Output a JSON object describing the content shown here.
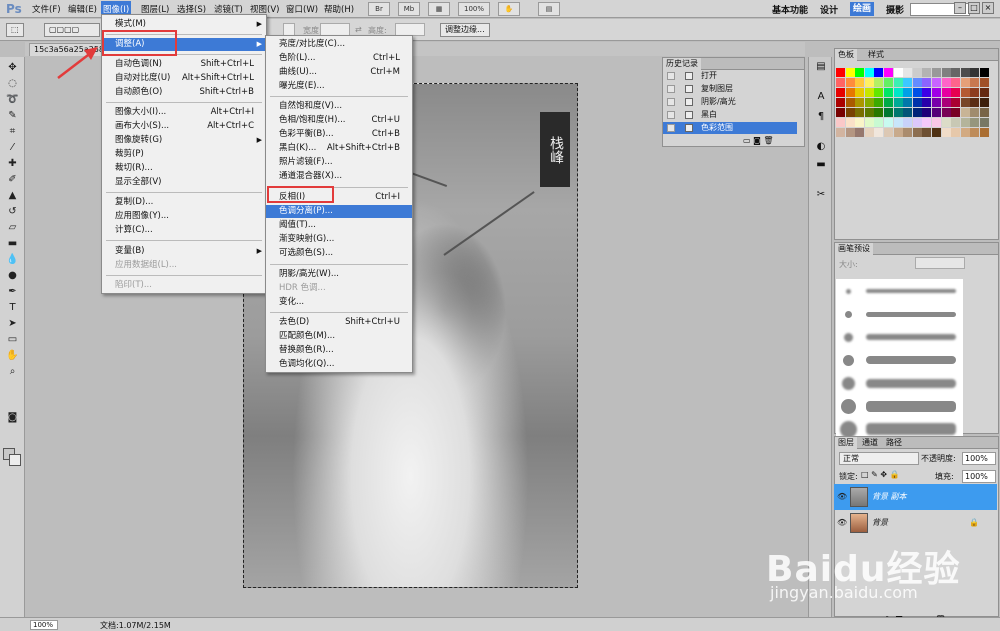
{
  "app": {
    "logo": "Ps"
  },
  "menubar": {
    "items": [
      "文件(F)",
      "编辑(E)",
      "图像(I)",
      "图层(L)",
      "选择(S)",
      "滤镜(T)",
      "视图(V)",
      "窗口(W)",
      "帮助(H)"
    ],
    "mini_buttons": [
      "Br",
      "Mb"
    ],
    "zoom": "100%",
    "workspaces": [
      "基本功能",
      "设计",
      "绘画",
      "摄影"
    ],
    "window_controls": [
      "–",
      "□",
      "×"
    ]
  },
  "options": {
    "adjust_edge": "调整边缘...",
    "width": "宽度:",
    "height": "高度:"
  },
  "document": {
    "tab": "15c3a56a25a2583"
  },
  "image_menu": {
    "items": [
      {
        "label": "模式(M)",
        "shortcut": "",
        "arrow": "▶"
      },
      {
        "label": "调整(A)",
        "shortcut": "",
        "arrow": "▶"
      },
      {
        "label": "自动色调(N)",
        "shortcut": "Shift+Ctrl+L"
      },
      {
        "label": "自动对比度(U)",
        "shortcut": "Alt+Shift+Ctrl+L"
      },
      {
        "label": "自动颜色(O)",
        "shortcut": "Shift+Ctrl+B"
      },
      {
        "label": "图像大小(I)...",
        "shortcut": "Alt+Ctrl+I"
      },
      {
        "label": "画布大小(S)...",
        "shortcut": "Alt+Ctrl+C"
      },
      {
        "label": "图像旋转(G)",
        "shortcut": "",
        "arrow": "▶"
      },
      {
        "label": "裁剪(P)",
        "shortcut": ""
      },
      {
        "label": "裁切(R)...",
        "shortcut": ""
      },
      {
        "label": "显示全部(V)",
        "shortcut": ""
      },
      {
        "label": "复制(D)...",
        "shortcut": ""
      },
      {
        "label": "应用图像(Y)...",
        "shortcut": ""
      },
      {
        "label": "计算(C)...",
        "shortcut": ""
      },
      {
        "label": "变量(B)",
        "shortcut": "",
        "arrow": "▶"
      },
      {
        "label": "应用数据组(L)...",
        "shortcut": ""
      },
      {
        "label": "陷印(T)...",
        "shortcut": ""
      }
    ]
  },
  "adjust_menu": {
    "items": [
      {
        "label": "亮度/对比度(C)...",
        "shortcut": ""
      },
      {
        "label": "色阶(L)...",
        "shortcut": "Ctrl+L"
      },
      {
        "label": "曲线(U)...",
        "shortcut": "Ctrl+M"
      },
      {
        "label": "曝光度(E)...",
        "shortcut": ""
      },
      {
        "label": "自然饱和度(V)...",
        "shortcut": ""
      },
      {
        "label": "色相/饱和度(H)...",
        "shortcut": "Ctrl+U"
      },
      {
        "label": "色彩平衡(B)...",
        "shortcut": "Ctrl+B"
      },
      {
        "label": "黑白(K)...",
        "shortcut": "Alt+Shift+Ctrl+B"
      },
      {
        "label": "照片滤镜(F)...",
        "shortcut": ""
      },
      {
        "label": "通道混合器(X)...",
        "shortcut": ""
      },
      {
        "label": "反相(I)",
        "shortcut": "Ctrl+I"
      },
      {
        "label": "色调分离(P)...",
        "shortcut": ""
      },
      {
        "label": "阈值(T)...",
        "shortcut": ""
      },
      {
        "label": "渐变映射(G)...",
        "shortcut": ""
      },
      {
        "label": "可选颜色(S)...",
        "shortcut": ""
      },
      {
        "label": "阴影/高光(W)...",
        "shortcut": ""
      },
      {
        "label": "HDR 色调...",
        "shortcut": ""
      },
      {
        "label": "变化...",
        "shortcut": ""
      },
      {
        "label": "去色(D)",
        "shortcut": "Shift+Ctrl+U"
      },
      {
        "label": "匹配颜色(M)...",
        "shortcut": ""
      },
      {
        "label": "替换颜色(R)...",
        "shortcut": ""
      },
      {
        "label": "色调均化(Q)...",
        "shortcut": ""
      }
    ]
  },
  "history": {
    "tab": "历史记录",
    "items": [
      "打开",
      "复制图层",
      "阴影/高光",
      "黑白",
      "色彩范围"
    ]
  },
  "swatches_panel": {
    "tabs": [
      "色板",
      "样式"
    ]
  },
  "brush_panel": {
    "tab": "画笔预设",
    "size_label": "大小:"
  },
  "layers": {
    "tabs": [
      "图层",
      "通道",
      "路径"
    ],
    "blend_mode": "正常",
    "opacity_label": "不透明度:",
    "opacity": "100%",
    "lock_label": "锁定:",
    "fill_label": "填充:",
    "fill": "100%",
    "items": [
      {
        "name": "背景 副本"
      },
      {
        "name": "背景"
      }
    ]
  },
  "status": {
    "zoom": "100%",
    "doc": "文档:1.07M/2.15M"
  },
  "stamp_text": "栈峰",
  "watermark": {
    "brand": "Baidu经验",
    "url": "jingyan.baidu.com"
  },
  "colors": {
    "menu_highlight": "#3d7ad6",
    "annotation_red": "#e23b3b",
    "selected_layer": "#3d9bef"
  }
}
